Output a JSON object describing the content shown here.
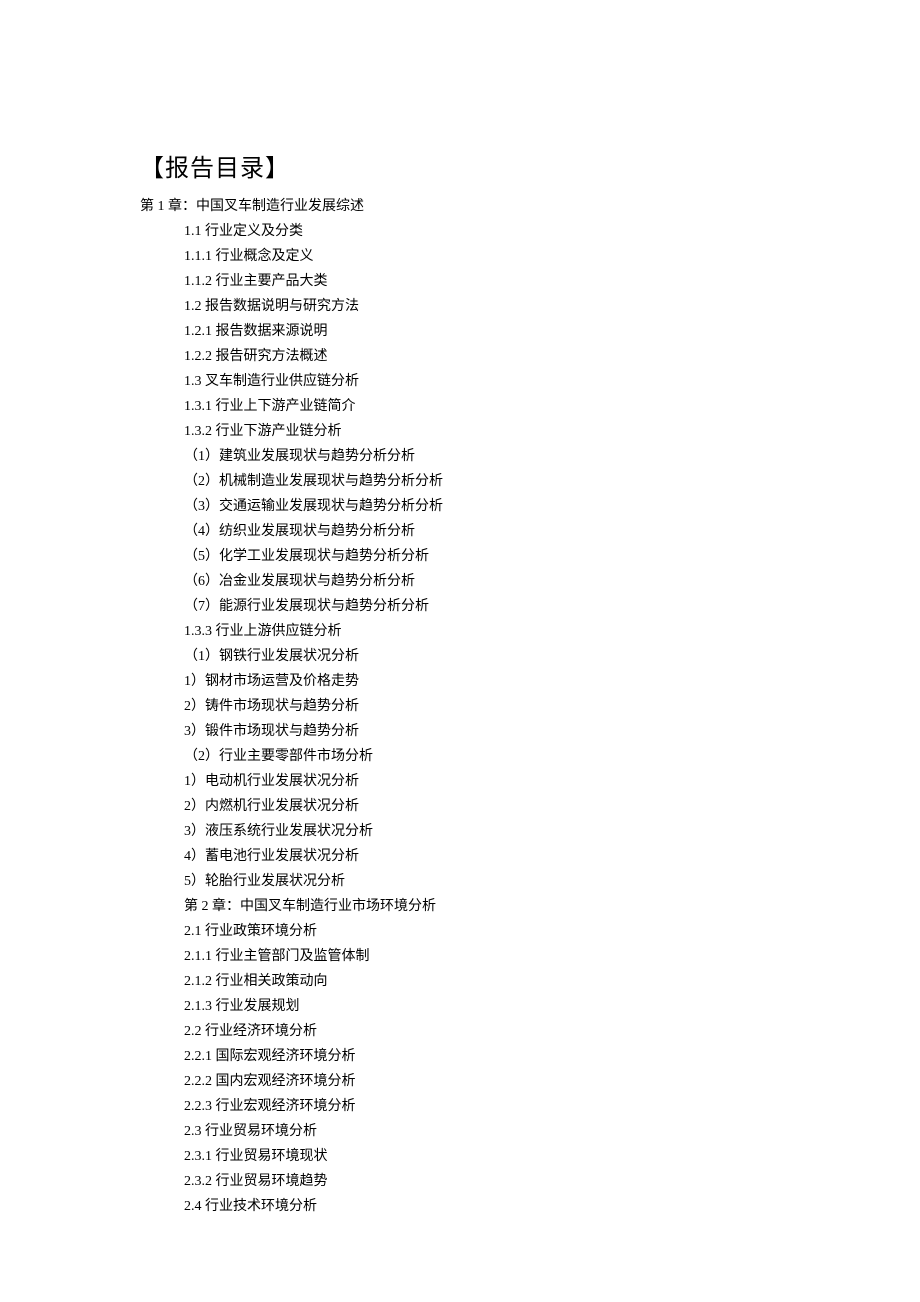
{
  "title": "【报告目录】",
  "chapter1_heading": "第 1 章：中国叉车制造行业发展综述",
  "items": [
    "1.1 行业定义及分类",
    "1.1.1 行业概念及定义",
    "1.1.2 行业主要产品大类",
    "1.2 报告数据说明与研究方法",
    "1.2.1 报告数据来源说明",
    "1.2.2 报告研究方法概述",
    "1.3 叉车制造行业供应链分析",
    "1.3.1 行业上下游产业链简介",
    "1.3.2 行业下游产业链分析",
    "（1）建筑业发展现状与趋势分析分析",
    "（2）机械制造业发展现状与趋势分析分析",
    "（3）交通运输业发展现状与趋势分析分析",
    "（4）纺织业发展现状与趋势分析分析",
    "（5）化学工业发展现状与趋势分析分析",
    "（6）冶金业发展现状与趋势分析分析",
    "（7）能源行业发展现状与趋势分析分析",
    "1.3.3 行业上游供应链分析",
    "（1）钢铁行业发展状况分析",
    "1）钢材市场运营及价格走势",
    "2）铸件市场现状与趋势分析",
    "3）锻件市场现状与趋势分析",
    "（2）行业主要零部件市场分析",
    "1）电动机行业发展状况分析",
    "2）内燃机行业发展状况分析",
    "3）液压系统行业发展状况分析",
    "4）蓄电池行业发展状况分析",
    "5）轮胎行业发展状况分析",
    "第 2 章：中国叉车制造行业市场环境分析",
    "2.1 行业政策环境分析",
    "2.1.1 行业主管部门及监管体制",
    "2.1.2 行业相关政策动向",
    "2.1.3 行业发展规划",
    "2.2 行业经济环境分析",
    "2.2.1 国际宏观经济环境分析",
    "2.2.2 国内宏观经济环境分析",
    "2.2.3 行业宏观经济环境分析",
    "2.3 行业贸易环境分析",
    "2.3.1 行业贸易环境现状",
    "2.3.2 行业贸易环境趋势",
    "2.4 行业技术环境分析"
  ]
}
